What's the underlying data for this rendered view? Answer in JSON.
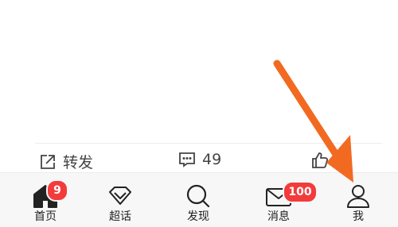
{
  "actions": {
    "share_label": "转发",
    "comment_count": "49"
  },
  "tabbar": {
    "home_label": "首页",
    "home_badge": "9",
    "super_label": "超话",
    "discover_label": "发现",
    "messages_label": "消息",
    "messages_badge": "100",
    "me_label": "我"
  },
  "colors": {
    "accent_arrow": "#f26a22",
    "badge": "#f33b3b",
    "tabbar_bg": "#f7f7f7"
  }
}
